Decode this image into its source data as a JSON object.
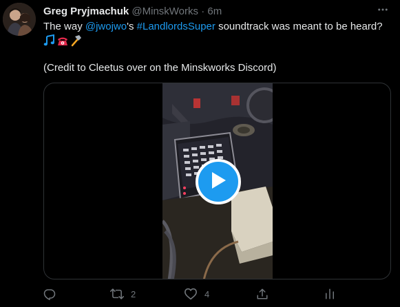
{
  "author": {
    "display_name": "Greg Pryjmachuk",
    "handle": "@MinskWorks",
    "separator": "·",
    "time": "6m"
  },
  "tweet": {
    "text_prefix": "The way ",
    "mention": "@jwojwo",
    "text_middle": "'s ",
    "hashtag": "#LandlordsSuper",
    "text_suffix": " soundtrack was meant to be heard?",
    "emojis": [
      "musical-notes-icon",
      "telephone-icon",
      "hammer-icon"
    ],
    "credit_line": "(Credit to Cleetus over on the Minskworks Discord)"
  },
  "media": {
    "type": "video",
    "play_icon": "play-icon"
  },
  "actions": {
    "reply": {
      "icon": "reply-icon",
      "count": ""
    },
    "retweet": {
      "icon": "retweet-icon",
      "count": "2"
    },
    "like": {
      "icon": "heart-icon",
      "count": "4"
    },
    "share": {
      "icon": "share-icon"
    },
    "analytics": {
      "icon": "analytics-icon"
    }
  },
  "colors": {
    "background": "#000000",
    "text": "#e7e9ea",
    "muted": "#71767b",
    "link": "#1d9bf0",
    "border": "#2f3336"
  }
}
